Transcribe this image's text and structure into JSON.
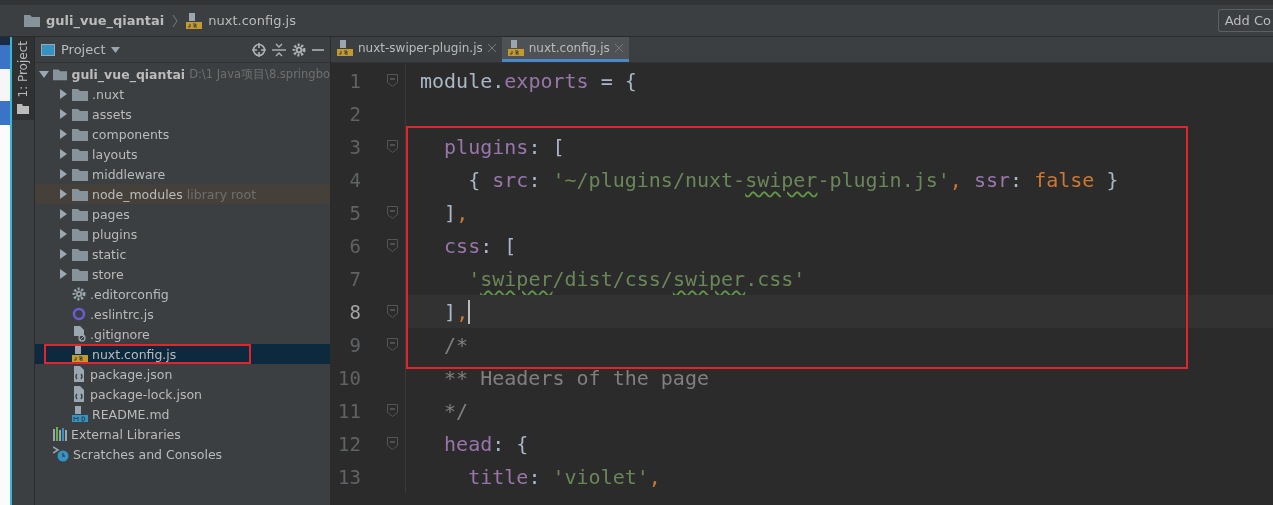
{
  "navbar": {
    "project": "guli_vue_qiantai",
    "file": "nuxt.config.js",
    "button": "Add Co"
  },
  "tool_stripe": {
    "label": "1: Project"
  },
  "project_panel": {
    "title": "Project",
    "tree": [
      {
        "label": "guli_vue_qiantai",
        "kind": "folder",
        "path": "D:\\1 Java项目\\8.springbo",
        "expanded": true,
        "selected": false,
        "framed": false,
        "children": [
          {
            "label": ".nuxt",
            "kind": "folder",
            "expanded": false,
            "selected": false,
            "framed": false
          },
          {
            "label": "assets",
            "kind": "folder",
            "expanded": false,
            "selected": false,
            "framed": false
          },
          {
            "label": "components",
            "kind": "folder",
            "expanded": false,
            "selected": false,
            "framed": false
          },
          {
            "label": "layouts",
            "kind": "folder",
            "expanded": false,
            "selected": false,
            "framed": false
          },
          {
            "label": "middleware",
            "kind": "folder",
            "expanded": false,
            "selected": false,
            "framed": false
          },
          {
            "label": "node_modules",
            "kind": "folder",
            "note": "library root",
            "expanded": false,
            "selected": false,
            "framed": false
          },
          {
            "label": "pages",
            "kind": "folder",
            "expanded": false,
            "selected": false,
            "framed": false
          },
          {
            "label": "plugins",
            "kind": "folder",
            "expanded": false,
            "selected": false,
            "framed": false
          },
          {
            "label": "static",
            "kind": "folder",
            "expanded": false,
            "selected": false,
            "framed": false
          },
          {
            "label": "store",
            "kind": "folder",
            "expanded": false,
            "selected": false,
            "framed": false
          },
          {
            "label": ".editorconfig",
            "kind": "settings",
            "selected": false,
            "framed": false
          },
          {
            "label": ".eslintrc.js",
            "kind": "lint",
            "selected": false,
            "framed": false
          },
          {
            "label": ".gitignore",
            "kind": "ignore",
            "selected": false,
            "framed": false
          },
          {
            "label": "nuxt.config.js",
            "kind": "script",
            "selected": true,
            "framed": true
          },
          {
            "label": "package.json",
            "kind": "json",
            "selected": false,
            "framed": false
          },
          {
            "label": "package-lock.json",
            "kind": "json",
            "selected": false,
            "framed": false
          },
          {
            "label": "README.md",
            "kind": "markdown",
            "selected": false,
            "framed": false
          }
        ]
      },
      {
        "label": "External Libraries",
        "kind": "libraries",
        "selected": false,
        "framed": false
      },
      {
        "label": "Scratches and Consoles",
        "kind": "scratches",
        "selected": false,
        "framed": false
      }
    ]
  },
  "editor": {
    "tabs": [
      {
        "label": "nuxt-swiper-plugin.js",
        "selected": false
      },
      {
        "label": "nuxt.config.js",
        "selected": true
      }
    ],
    "blocks": [
      {
        "framed": false,
        "lines": [
          {
            "number": "1",
            "fold": true,
            "current": false,
            "tokens": [
              {
                "text": "module.",
                "kind": "plain"
              },
              {
                "text": "exports",
                "kind": "prop"
              },
              {
                "text": " = {",
                "kind": "plain"
              }
            ]
          },
          {
            "number": "2",
            "fold": false,
            "current": false
          }
        ]
      },
      {
        "framed": true,
        "lines": [
          {
            "number": "3",
            "fold": true,
            "current": false,
            "tokens": [
              {
                "text": "  plugins",
                "kind": "prop"
              },
              {
                "text": ": [",
                "kind": "plain"
              }
            ]
          },
          {
            "number": "4",
            "fold": false,
            "current": false,
            "tokens": [
              {
                "text": "    { ",
                "kind": "plain"
              },
              {
                "text": "src",
                "kind": "prop"
              },
              {
                "text": ": ",
                "kind": "plain"
              },
              {
                "text": "'~/plugins/nuxt-",
                "kind": "str"
              },
              {
                "text": "swiper",
                "kind": "typo"
              },
              {
                "text": "-plugin.js'",
                "kind": "str"
              },
              {
                "text": ", ",
                "kind": "kw"
              },
              {
                "text": "ssr",
                "kind": "prop"
              },
              {
                "text": ": ",
                "kind": "plain"
              },
              {
                "text": "false",
                "kind": "kw"
              },
              {
                "text": " }",
                "kind": "plain"
              }
            ]
          },
          {
            "number": "5",
            "fold": true,
            "current": false,
            "tokens": [
              {
                "text": "  ]",
                "kind": "plain"
              },
              {
                "text": ",",
                "kind": "kw"
              }
            ]
          },
          {
            "number": "6",
            "fold": true,
            "current": false,
            "tokens": [
              {
                "text": "  css",
                "kind": "prop"
              },
              {
                "text": ": [",
                "kind": "plain"
              }
            ]
          },
          {
            "number": "7",
            "fold": false,
            "current": false,
            "tokens": [
              {
                "text": "    '",
                "kind": "str"
              },
              {
                "text": "swiper",
                "kind": "typo"
              },
              {
                "text": "/dist/css/",
                "kind": "str"
              },
              {
                "text": "swiper",
                "kind": "typo"
              },
              {
                "text": ".css'",
                "kind": "str"
              }
            ]
          },
          {
            "number": "8",
            "fold": true,
            "current": true,
            "tokens": [
              {
                "text": "  ]",
                "kind": "plain"
              },
              {
                "text": ",",
                "kind": "kw"
              }
            ]
          },
          {
            "number": "9",
            "fold": true,
            "current": false,
            "tokens": [
              {
                "text": "  /*",
                "kind": "comment"
              }
            ]
          }
        ]
      },
      {
        "framed": false,
        "lines": [
          {
            "number": "10",
            "fold": false,
            "current": false,
            "tokens": [
              {
                "text": "  ** Headers of the page",
                "kind": "comment"
              }
            ]
          },
          {
            "number": "11",
            "fold": true,
            "current": false,
            "tokens": [
              {
                "text": "  */",
                "kind": "comment"
              }
            ]
          },
          {
            "number": "12",
            "fold": true,
            "current": false,
            "tokens": [
              {
                "text": "  head",
                "kind": "prop"
              },
              {
                "text": ": {",
                "kind": "plain"
              }
            ]
          },
          {
            "number": "13",
            "fold": false,
            "current": false,
            "tokens": [
              {
                "text": "    title",
                "kind": "prop"
              },
              {
                "text": ": ",
                "kind": "plain"
              },
              {
                "text": "'violet'",
                "kind": "str"
              },
              {
                "text": ",",
                "kind": "kw"
              }
            ]
          }
        ]
      }
    ]
  }
}
